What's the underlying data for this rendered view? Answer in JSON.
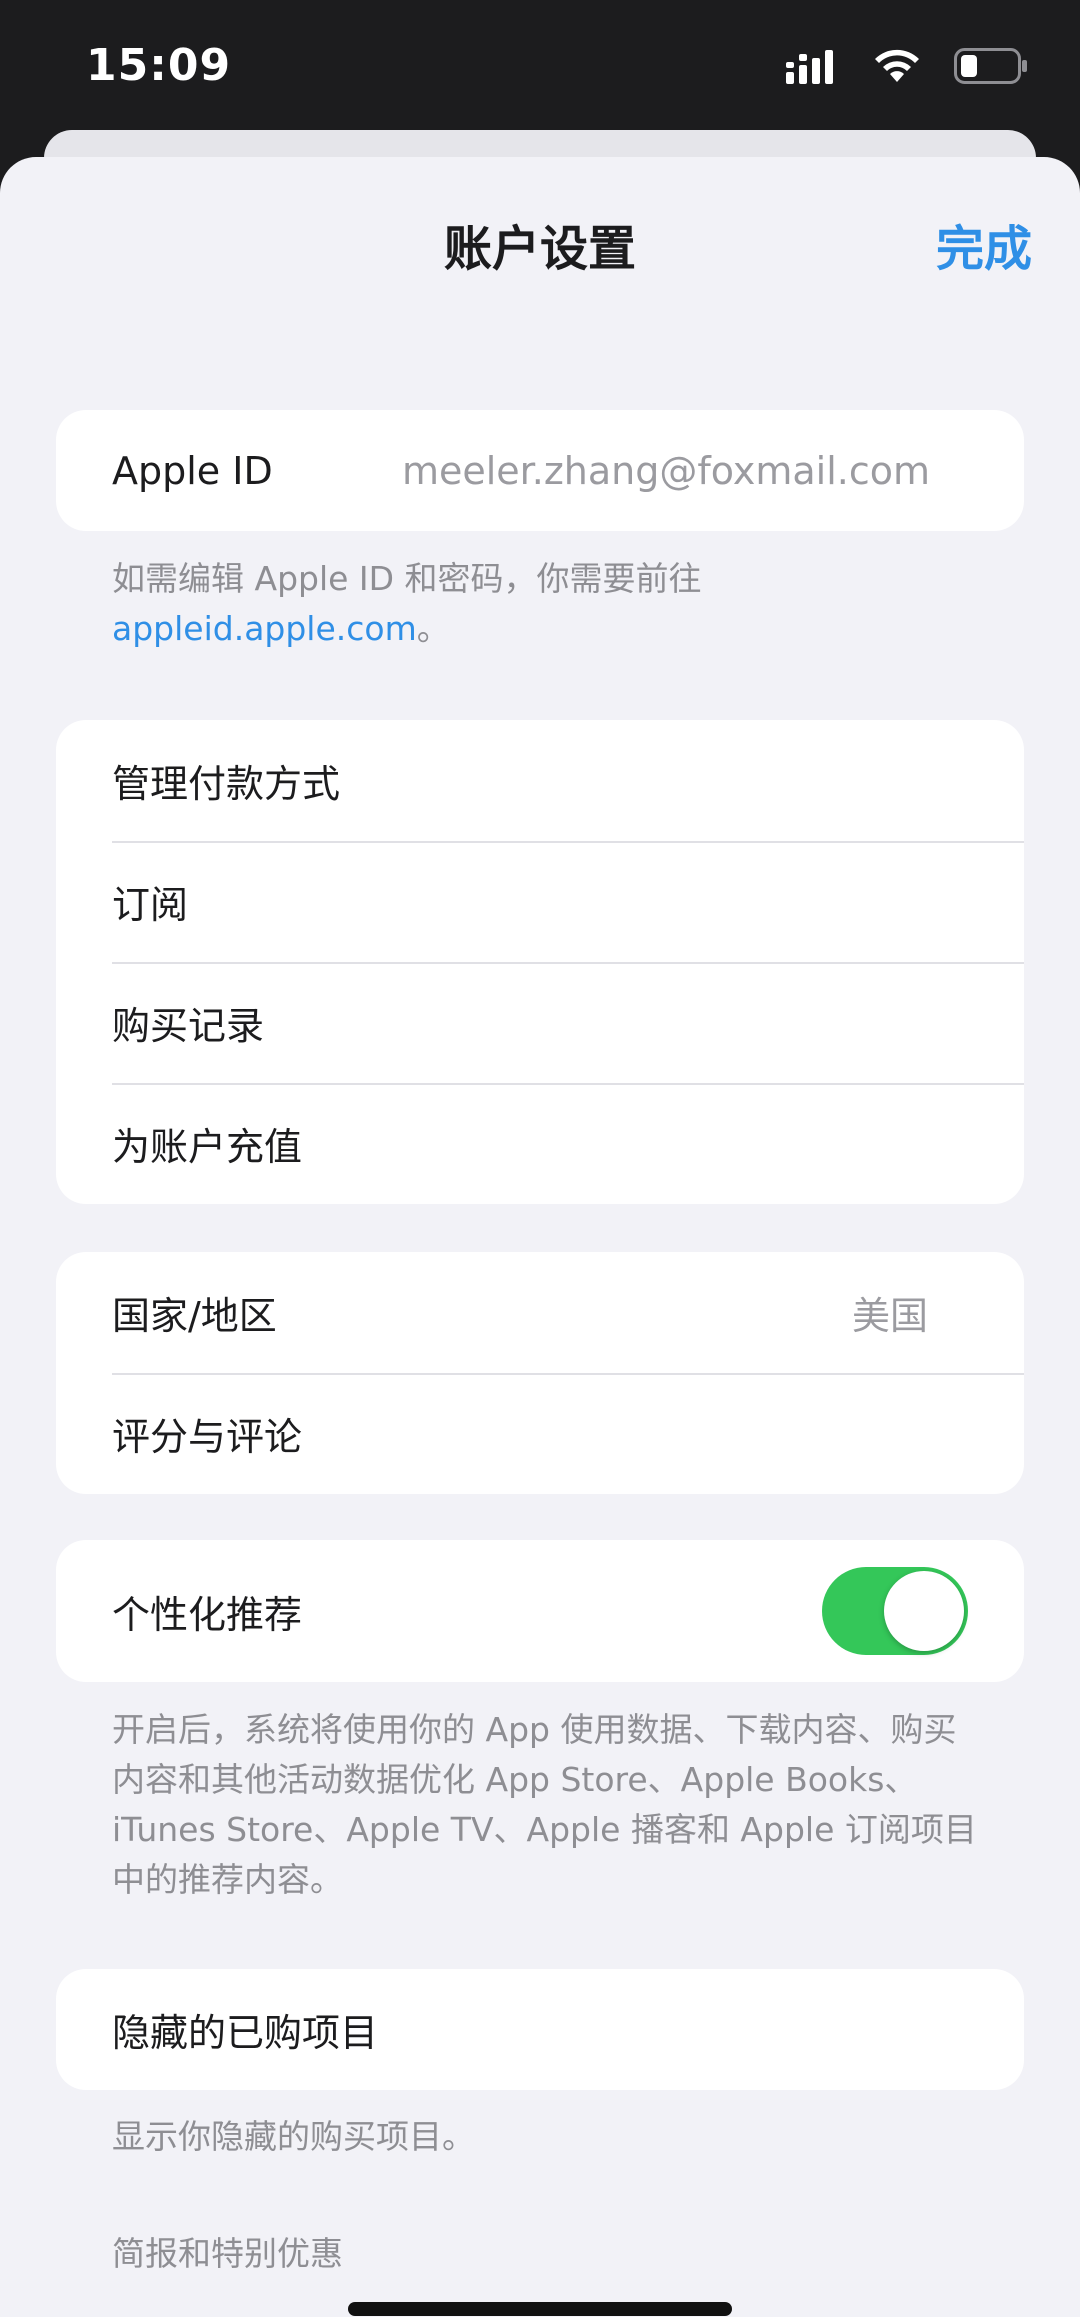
{
  "status": {
    "time": "15:09",
    "icons": [
      "signal-icon",
      "wifi-icon",
      "battery-icon"
    ]
  },
  "nav": {
    "title": "账户设置",
    "done": "完成"
  },
  "apple_id": {
    "label": "Apple ID",
    "value": "meeler.zhang@foxmail.com",
    "note_prefix": "如需编辑 Apple ID 和密码，你需要前往",
    "note_link": "appleid.apple.com",
    "note_suffix": "。"
  },
  "payment_group": {
    "items": [
      "管理付款方式",
      "订阅",
      "购买记录",
      "为账户充值"
    ]
  },
  "region_group": {
    "country_label": "国家/地区",
    "country_value": "美国",
    "ratings_label": "评分与评论"
  },
  "personalization": {
    "label": "个性化推荐",
    "enabled": true,
    "note": "开启后，系统将使用你的 App 使用数据、下载内容、购买内容和其他活动数据优化 App Store、Apple Books、iTunes Store、Apple TV、Apple 播客和 Apple 订阅项目中的推荐内容。"
  },
  "hidden": {
    "label": "隐藏的已购项目",
    "note": "显示你隐藏的购买项目。"
  },
  "newsletter_header": "简报和特别优惠",
  "colors": {
    "accent": "#2f8fe6",
    "toggle_on": "#34c759",
    "background": "#f2f2f7"
  }
}
